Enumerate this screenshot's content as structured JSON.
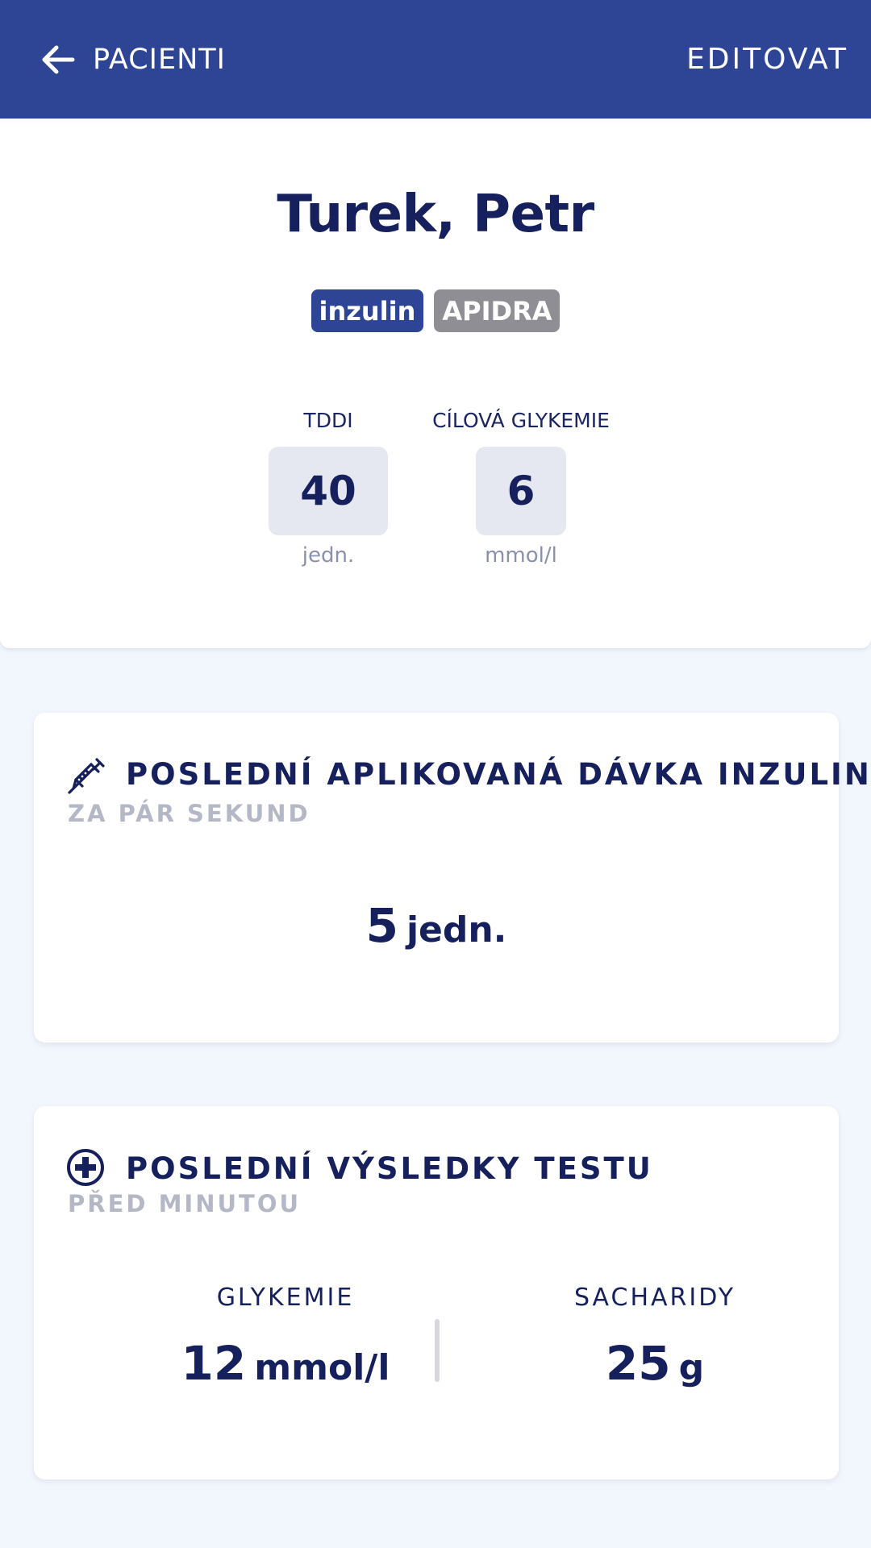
{
  "appbar": {
    "back_label": "PACIENTI",
    "edit_label": "EDITOVAT",
    "color": "#2e4596"
  },
  "patient": {
    "name": "Turek, Petr",
    "badges": [
      {
        "label": "inzulin",
        "color": "#2e4596"
      },
      {
        "label": "APIDRA",
        "color": "#8e8e94"
      }
    ],
    "stats": [
      {
        "label": "TDDI",
        "value": "40",
        "unit": "jedn."
      },
      {
        "label": "CÍLOVÁ GLYKEMIE",
        "value": "6",
        "unit": "mmol/l"
      }
    ]
  },
  "last_dose": {
    "icon": "syringe-icon",
    "title": "POSLEDNÍ APLIKOVANÁ DÁVKA INZULINU",
    "subtitle": "ZA PÁR SEKUND",
    "value": "5",
    "unit": "jedn."
  },
  "last_test": {
    "icon": "plus-circle-icon",
    "title": "POSLEDNÍ VÝSLEDKY TESTU",
    "subtitle": "PŘED MINUTOU",
    "glykemie": {
      "label": "GLYKEMIE",
      "value": "12",
      "unit": "mmol/l"
    },
    "sacharidy": {
      "label": "SACHARIDY",
      "value": "25",
      "unit": "g"
    }
  }
}
